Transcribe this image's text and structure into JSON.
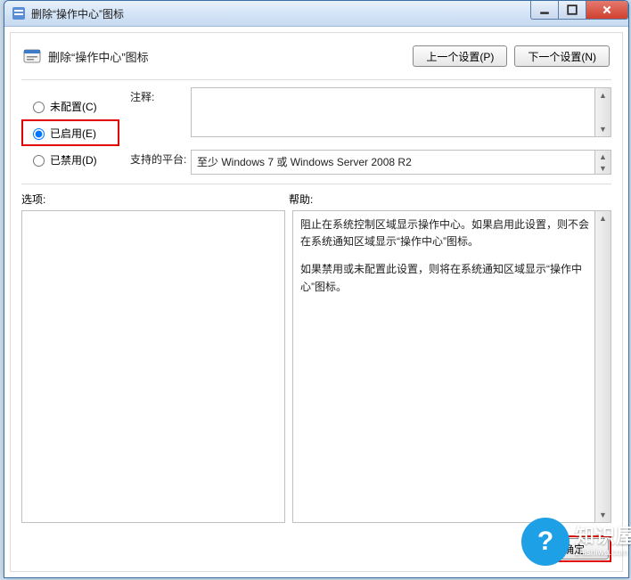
{
  "window": {
    "title": "删除“操作中心”图标"
  },
  "header": {
    "page_title": "删除“操作中心”图标",
    "prev_button": "上一个设置(P)",
    "next_button": "下一个设置(N)"
  },
  "radios": {
    "not_configured": "未配置(C)",
    "enabled": "已启用(E)",
    "disabled": "已禁用(D)",
    "selected": "enabled"
  },
  "comment": {
    "label": "注释:",
    "value": ""
  },
  "platform": {
    "label": "支持的平台:",
    "value": "至少 Windows 7 或 Windows Server 2008 R2"
  },
  "sections": {
    "options_label": "选项:",
    "help_label": "帮助:"
  },
  "help": {
    "p1": "阻止在系统控制区域显示操作中心。如果启用此设置，则不会在系统通知区域显示“操作中心”图标。",
    "p2": "如果禁用或未配置此设置，则将在系统通知区域显示“操作中心”图标。"
  },
  "footer": {
    "ok": "确定"
  },
  "watermark": {
    "brand": "知识屋",
    "url": "zhishiwu.com",
    "icon_char": "?"
  }
}
